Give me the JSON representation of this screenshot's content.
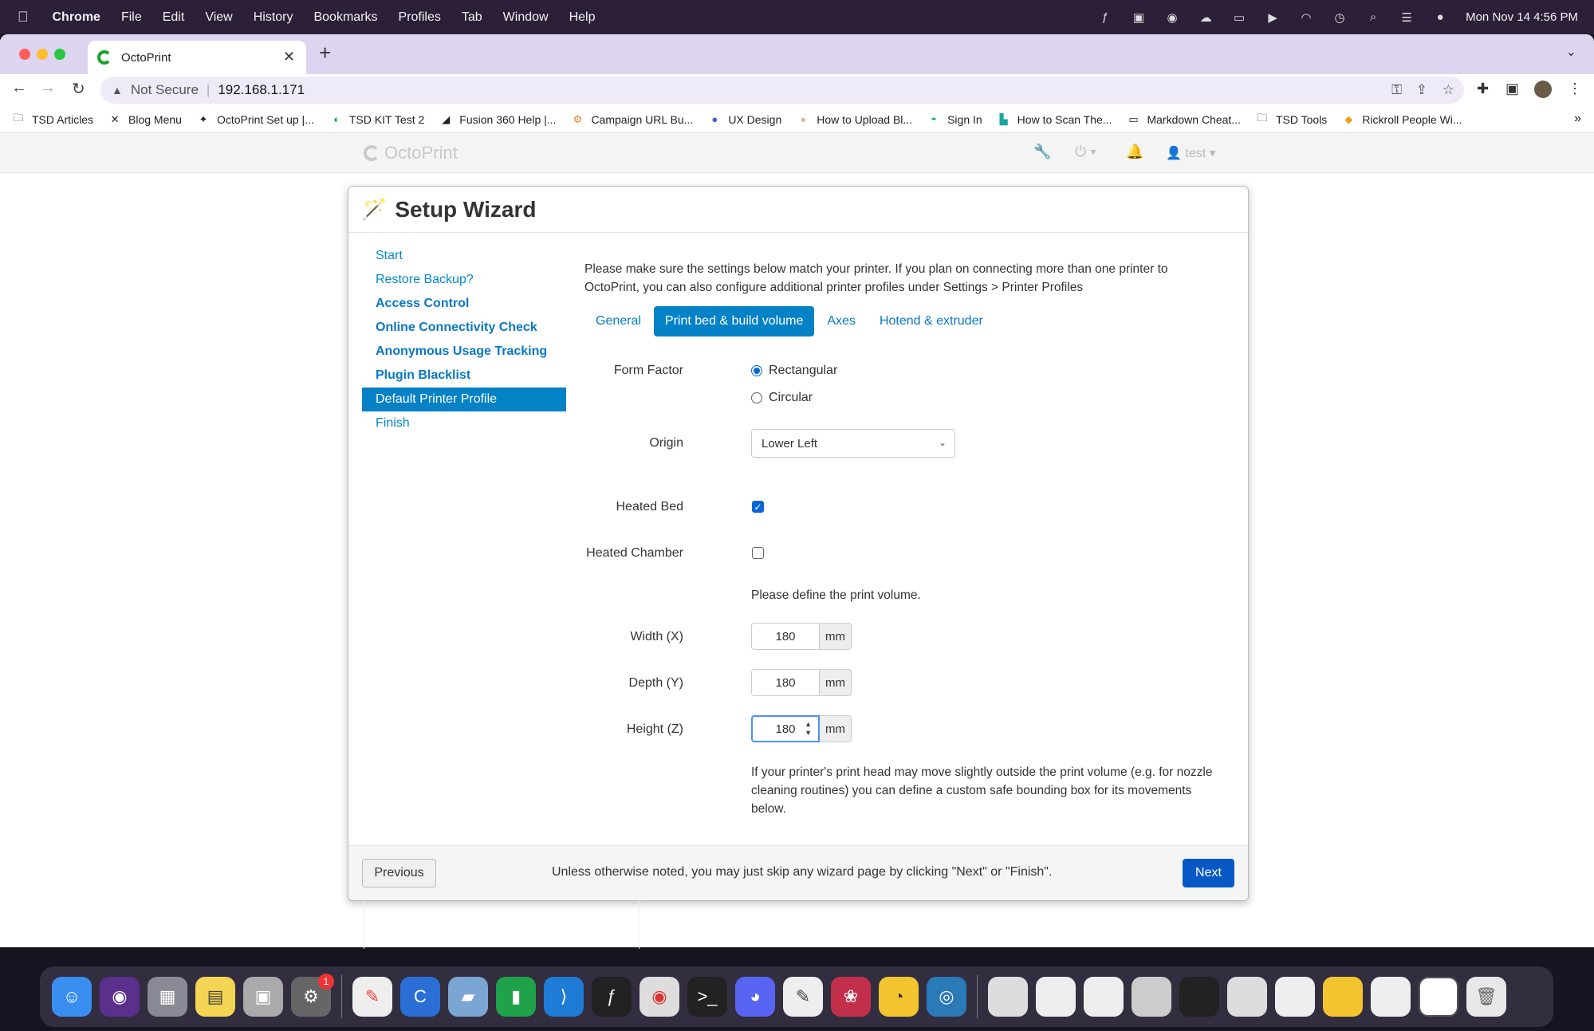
{
  "menubar": {
    "apple": "",
    "app": "Chrome",
    "items": [
      "File",
      "Edit",
      "View",
      "History",
      "Bookmarks",
      "Profiles",
      "Tab",
      "Window",
      "Help"
    ],
    "datetime": "Mon Nov 14  4:56 PM"
  },
  "browser": {
    "tab_title": "OctoPrint",
    "address": {
      "security": "Not Secure",
      "url": "192.168.1.171"
    },
    "bookmarks": [
      "TSD Articles",
      "Blog Menu",
      "OctoPrint Set up |...",
      "TSD KIT Test 2",
      "Fusion 360 Help |...",
      "Campaign URL Bu...",
      "UX Design",
      "How to Upload Bl...",
      "Sign In",
      "How to Scan The...",
      "Markdown Cheat...",
      "TSD Tools",
      "Rickroll People Wi..."
    ]
  },
  "octoprint": {
    "brand": "OctoPrint",
    "user": "test"
  },
  "wizard": {
    "title": "Setup Wizard",
    "steps": [
      {
        "label": "Start"
      },
      {
        "label": "Restore Backup?"
      },
      {
        "label": "Access Control"
      },
      {
        "label": "Online Connectivity Check"
      },
      {
        "label": "Anonymous Usage Tracking"
      },
      {
        "label": "Plugin Blacklist"
      },
      {
        "label": "Default Printer Profile"
      },
      {
        "label": "Finish"
      }
    ],
    "intro": "Please make sure the settings below match your printer. If you plan on connecting more than one printer to OctoPrint, you can also configure additional printer profiles under Settings > Printer Profiles",
    "tabs": [
      "General",
      "Print bed & build volume",
      "Axes",
      "Hotend & extruder"
    ],
    "form": {
      "form_factor_label": "Form Factor",
      "rectangular": "Rectangular",
      "circular": "Circular",
      "origin_label": "Origin",
      "origin_value": "Lower Left",
      "heated_bed_label": "Heated Bed",
      "heated_chamber_label": "Heated Chamber",
      "volume_note": "Please define the print volume.",
      "width_label": "Width (X)",
      "width_value": "180",
      "depth_label": "Depth (Y)",
      "depth_value": "180",
      "height_label": "Height (Z)",
      "height_value": "180",
      "unit": "mm",
      "bbox_note": "If your printer's print head may move slightly outside the print volume (e.g. for nozzle cleaning routines) you can define a custom safe bounding box for its movements below."
    },
    "footer": {
      "previous": "Previous",
      "note": "Unless otherwise noted, you may just skip any wizard page by clicking \"Next\" or \"Finish\".",
      "next": "Next"
    }
  },
  "dock": {
    "settings_badge": "1"
  }
}
